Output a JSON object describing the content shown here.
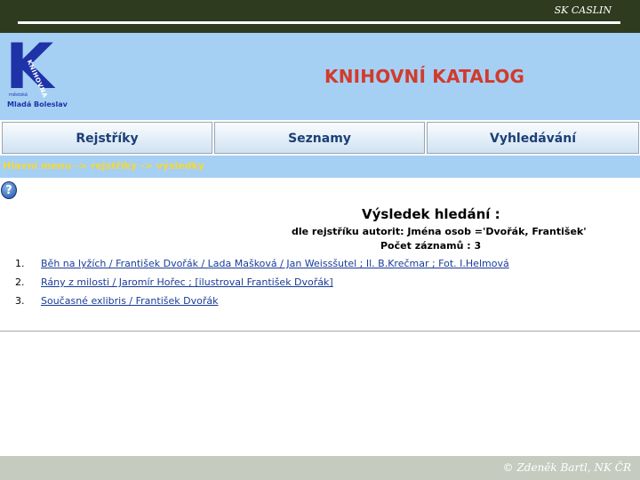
{
  "slide": {
    "corner_label": "SK CASLIN",
    "footer_credit": "© Zdeněk Bartl, NK ČR"
  },
  "logo": {
    "letter": "K",
    "vertical_text": "KNIHOVNA",
    "small_text": "městská",
    "city": "Mladá Boleslav"
  },
  "header": {
    "title": "KNIHOVNÍ KATALOG"
  },
  "nav": {
    "tabs": [
      {
        "label": "Rejstříky"
      },
      {
        "label": "Seznamy"
      },
      {
        "label": "Vyhledávání"
      }
    ]
  },
  "breadcrumb": {
    "text": "Hlavní menu -> rejstříky -> výsledky"
  },
  "help": {
    "icon": "question-icon",
    "glyph": "?"
  },
  "results": {
    "title": "Výsledek hledání :",
    "query": "dle rejstříku autorit: Jména osob ='Dvořák, František'",
    "count": "Počet záznamů : 3",
    "items": [
      {
        "num": "1.",
        "text": "Běh na lyžích / František Dvořák / Lada Mašková / Jan Weissšutel ; Il. B.Krečmar ; Fot. I.Helmová"
      },
      {
        "num": "2.",
        "text": "Rány z milosti / Jaromír Hořec ; [ilustroval František Dvořák]"
      },
      {
        "num": "3.",
        "text": "Současné exlibris / František Dvořák"
      }
    ]
  },
  "colors": {
    "header_bg": "#a6cff4",
    "title_red": "#d13b2c",
    "tab_text": "#1c3f78",
    "breadcrumb_yellow": "#f3d838",
    "link_blue": "#1a3c9a",
    "slide_top": "#2e3b1f",
    "slide_bottom": "#c6cbbf"
  }
}
